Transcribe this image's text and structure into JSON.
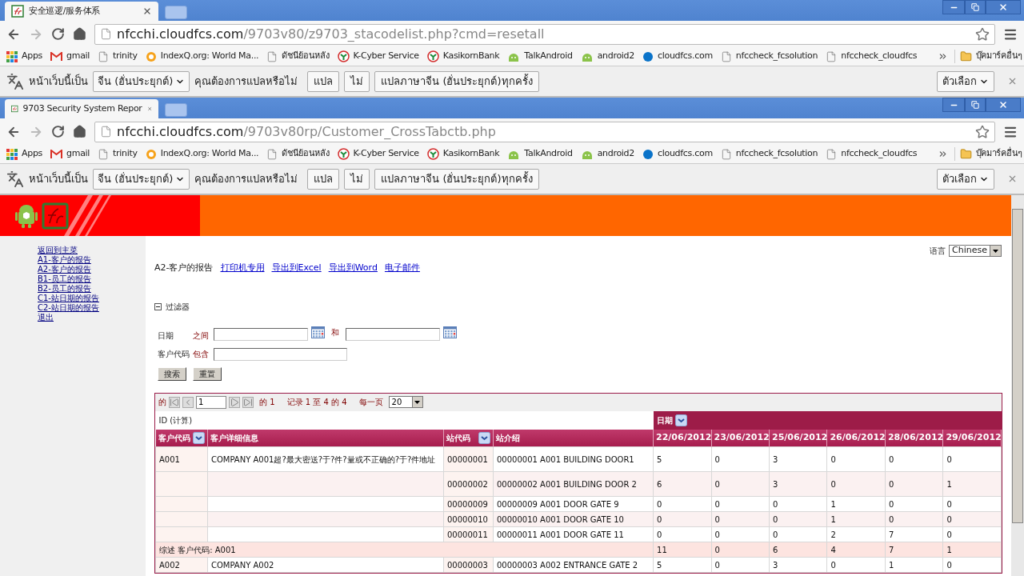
{
  "windows": [
    {
      "tab_title": "安全巡逻/服务体系",
      "url_host": "nfcchi.cloudfcs.com",
      "url_path": "/9703v80/z9703_stacodelist.php?cmd=resetall",
      "bookmarks": [
        {
          "label": "Apps",
          "kind": "apps"
        },
        {
          "label": "gmail",
          "kind": "gmail"
        },
        {
          "label": "trinity",
          "kind": "page"
        },
        {
          "label": "IndexQ.org: World Ma...",
          "kind": "indexq"
        },
        {
          "label": "ดัชนีย้อนหลัง",
          "kind": "page"
        },
        {
          "label": "K-Cyber Service",
          "kind": "kbank"
        },
        {
          "label": "KasikornBank",
          "kind": "kbank"
        },
        {
          "label": "TalkAndroid",
          "kind": "android"
        },
        {
          "label": "android2",
          "kind": "android"
        },
        {
          "label": "cloudfcs.com",
          "kind": "cloud"
        },
        {
          "label": "nfccheck_fcsolution",
          "kind": "page"
        },
        {
          "label": "nfccheck_cloudfcs",
          "kind": "page"
        }
      ],
      "other_bookmarks": "บุ๊คมาร์คอื่นๆ",
      "translate": {
        "prefix": "หน้าเว็บนี้เป็น",
        "language": "จีน (ฮั่นประยุกต์)",
        "question": "คุณต้องการแปลหรือไม่",
        "buttons": [
          "แปล",
          "ไม่",
          "แปลภาษาจีน (ฮั่นประยุกต์)ทุกครั้ง"
        ],
        "options": "ตัวเลือก"
      }
    },
    {
      "tab_title": "9703 Security System Repor",
      "url_host": "nfcchi.cloudfcs.com",
      "url_path": "/9703v80rp/Customer_CrossTabctb.php",
      "bookmarks": [
        {
          "label": "Apps",
          "kind": "apps"
        },
        {
          "label": "gmail",
          "kind": "gmail"
        },
        {
          "label": "trinity",
          "kind": "page"
        },
        {
          "label": "IndexQ.org: World Ma...",
          "kind": "indexq"
        },
        {
          "label": "ดัชนีย้อนหลัง",
          "kind": "page"
        },
        {
          "label": "K-Cyber Service",
          "kind": "kbank"
        },
        {
          "label": "KasikornBank",
          "kind": "kbank"
        },
        {
          "label": "TalkAndroid",
          "kind": "android"
        },
        {
          "label": "android2",
          "kind": "android"
        },
        {
          "label": "cloudfcs.com",
          "kind": "cloud"
        },
        {
          "label": "nfccheck_fcsolution",
          "kind": "page"
        },
        {
          "label": "nfccheck_cloudfcs",
          "kind": "page"
        }
      ],
      "other_bookmarks": "บุ๊คมาร์คอื่นๆ",
      "translate": {
        "prefix": "หน้าเว็บนี้เป็น",
        "language": "จีน (ฮั่นประยุกต์)",
        "question": "คุณต้องการแปลหรือไม่",
        "buttons": [
          "แปล",
          "ไม่",
          "แปลภาษาจีน (ฮั่นประยุกต์)ทุกครั้ง"
        ],
        "options": "ตัวเลือก"
      }
    }
  ],
  "sidebar": {
    "links": [
      "返回到主菜",
      "A1-客户的报告",
      "A2-客户的报告",
      "B1-员工的报告",
      "B2-员工的报告",
      "C1-站日期的报告",
      "C2-站日期的报告",
      "退出"
    ]
  },
  "language": {
    "label": "语言",
    "value": "Chinese"
  },
  "report": {
    "title": "A2-客户的报告",
    "links": [
      "打印机专用",
      "导出到Excel",
      "导出到Word",
      "电子邮件"
    ]
  },
  "filter": {
    "title": "过滤器",
    "expanded": true,
    "date_label": "日期",
    "between": "之间",
    "and": "和",
    "customer_label": "客户代码",
    "contains": "包含",
    "search": "搜索",
    "reset": "重置"
  },
  "pager": {
    "page_label": "的",
    "page": "1",
    "of": "的 1",
    "records": "记录 1 至 4 的 4",
    "per_page_label": "每一页",
    "per_page": "20"
  },
  "table": {
    "id_label": "ID (计算)",
    "date_group": "日期",
    "columns": [
      {
        "label": "客户代码",
        "menu": true
      },
      {
        "label": "客户详细信息",
        "menu": false
      },
      {
        "label": "站代码",
        "menu": true
      },
      {
        "label": "站介绍",
        "menu": false
      }
    ],
    "dates": [
      "22/06/2012",
      "23/06/2012",
      "25/06/2012",
      "26/06/2012",
      "28/06/2012",
      "29/06/2012"
    ],
    "rows": [
      {
        "kind": "data",
        "customer": "A001",
        "detail": "COMPANY A001超?最大密送?于?件?量或不正确的?于?件地址",
        "station": "00000001",
        "intro": "00000001 A001 BUILDING DOOR1",
        "counts": [
          "5",
          "0",
          "3",
          "0",
          "0",
          "0"
        ]
      },
      {
        "kind": "data",
        "station": "00000002",
        "intro": "00000002 A001 BUILDING DOOR 2",
        "counts": [
          "6",
          "0",
          "3",
          "0",
          "0",
          "1"
        ]
      },
      {
        "kind": "data",
        "station": "00000009",
        "intro": "00000009 A001 DOOR GATE 9",
        "counts": [
          "0",
          "0",
          "0",
          "1",
          "0",
          "0"
        ]
      },
      {
        "kind": "data",
        "station": "00000010",
        "intro": "00000010 A001 DOOR GATE 10",
        "counts": [
          "0",
          "0",
          "0",
          "1",
          "0",
          "0"
        ]
      },
      {
        "kind": "data",
        "station": "00000011",
        "intro": "00000011 A001 DOOR GATE 11",
        "counts": [
          "0",
          "0",
          "0",
          "2",
          "7",
          "0"
        ]
      },
      {
        "kind": "summary",
        "label": "综述 客户代码: A001",
        "counts": [
          "11",
          "0",
          "6",
          "4",
          "7",
          "1"
        ]
      },
      {
        "kind": "data",
        "customer": "A002",
        "detail": "COMPANY A002",
        "station": "00000003",
        "intro": "00000003 A002 ENTRANCE GATE 2",
        "counts": [
          "5",
          "0",
          "3",
          "0",
          "1",
          "0"
        ]
      }
    ]
  }
}
